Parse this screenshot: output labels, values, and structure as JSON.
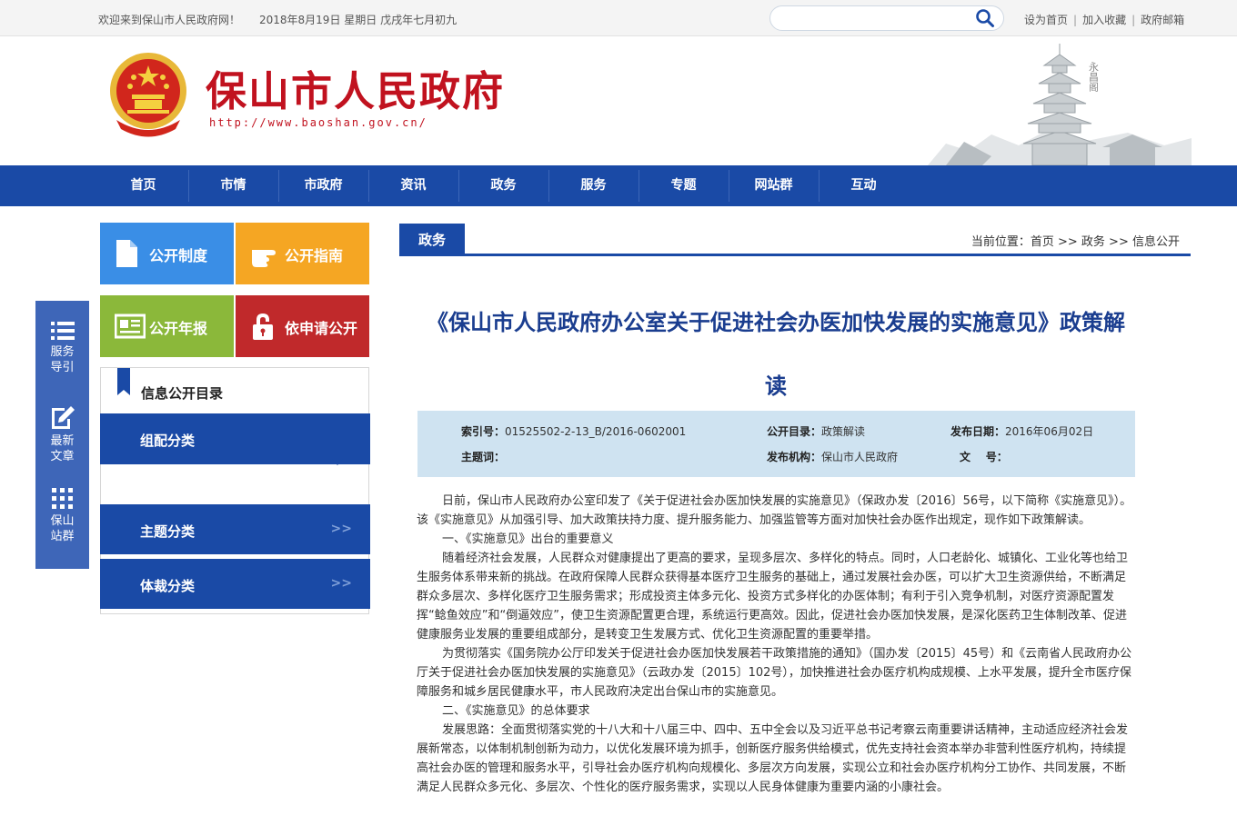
{
  "topbar": {
    "welcome": "欢迎来到保山市人民政府网！",
    "date": "2018年8月19日  星期日  戊戌年七月初九",
    "search_placeholder": "",
    "links": [
      "设为首页",
      "加入收藏",
      "政府邮箱"
    ]
  },
  "header": {
    "title": "保山市人民政府",
    "url": "http://www.baoshan.gov.cn/",
    "pagoda_caption": "永昌阁"
  },
  "nav": [
    "首页",
    "市情",
    "市政府",
    "资讯",
    "政务",
    "服务",
    "专题",
    "网站群",
    "互动"
  ],
  "floatbar": [
    {
      "label": "服务\n导引",
      "icon": "list-icon"
    },
    {
      "label": "最新\n文章",
      "icon": "edit-icon"
    },
    {
      "label": "保山\n站群",
      "icon": "grid-icon"
    }
  ],
  "tiles": {
    "gongkai_zhidu": "公开制度",
    "gongkai_zhinan": "公开指南",
    "gongkai_nianbao": "公开年报",
    "yishenqing": "依申请公开"
  },
  "catalog": {
    "title": "信息公开目录",
    "zupei": "组配分类",
    "zhuti": "主题分类",
    "ticai": "体裁分类",
    "arrows": ">>"
  },
  "section": {
    "tab": "政务",
    "breadcrumb_prefix": "当前位置：",
    "crumbs": [
      "首页",
      "政务",
      "信息公开"
    ],
    "crumb_sep": " >> "
  },
  "article": {
    "title": "《保山市人民政府办公室关于促进社会办医加快发展的实施意见》政策解读",
    "meta": {
      "index_label": "索引号：",
      "index_value": "01525502-2-13_B/2016-0602001",
      "catalog_label": "公开目录：",
      "catalog_value": "政策解读",
      "date_label": "发布日期：",
      "date_value": "2016年06月02日",
      "keywords_label": "主题词：",
      "keywords_value": "",
      "org_label": "发布机构：",
      "org_value": "保山市人民政府",
      "docno_label": "文    号：",
      "docno_value": ""
    },
    "paragraphs": [
      "日前，保山市人民政府办公室印发了《关于促进社会办医加快发展的实施意见》（保政办发〔2016〕56号，以下简称《实施意见》）。该《实施意见》从加强引导、加大政策扶持力度、提升服务能力、加强监管等方面对加快社会办医作出规定，现作如下政策解读。",
      "一、《实施意见》出台的重要意义",
      "随着经济社会发展，人民群众对健康提出了更高的要求，呈现多层次、多样化的特点。同时，人口老龄化、城镇化、工业化等也给卫生服务体系带来新的挑战。在政府保障人民群众获得基本医疗卫生服务的基础上，通过发展社会办医，可以扩大卫生资源供给，不断满足群众多层次、多样化医疗卫生服务需求；形成投资主体多元化、投资方式多样化的办医体制；有利于引入竞争机制，对医疗资源配置发挥“鲶鱼效应”和“倒逼效应”，使卫生资源配置更合理，系统运行更高效。因此，促进社会办医加快发展，是深化医药卫生体制改革、促进健康服务业发展的重要组成部分，是转变卫生发展方式、优化卫生资源配置的重要举措。",
      "为贯彻落实《国务院办公厅印发关于促进社会办医加快发展若干政策措施的通知》（国办发〔2015〕45号）和《云南省人民政府办公厅关于促进社会办医加快发展的实施意见》（云政办发〔2015〕102号），加快推进社会办医疗机构成规模、上水平发展，提升全市医疗保障服务和城乡居民健康水平，市人民政府决定出台保山市的实施意见。",
      "二、《实施意见》的总体要求",
      "发展思路：全面贯彻落实党的十八大和十八届三中、四中、五中全会以及习近平总书记考察云南重要讲话精神，主动适应经济社会发展新常态，以体制机制创新为动力，以优化发展环境为抓手，创新医疗服务供给模式，优先支持社会资本举办非营利性医疗机构，持续提高社会办医的管理和服务水平，引导社会办医疗机构向规模化、多层次方向发展，实现公立和社会办医疗机构分工协作、共同发展，不断满足人民群众多元化、多层次、个性化的医疗服务需求，实现以人民身体健康为重要内涵的小康社会。"
    ]
  },
  "colors": {
    "nav_blue": "#1a4aa6",
    "title_red": "#c1121f",
    "tile_blue": "#3a8ee6",
    "tile_orange": "#f5a623",
    "tile_green": "#8bb83a",
    "tile_red": "#c0292b",
    "meta_bg": "#cfe3f1"
  }
}
